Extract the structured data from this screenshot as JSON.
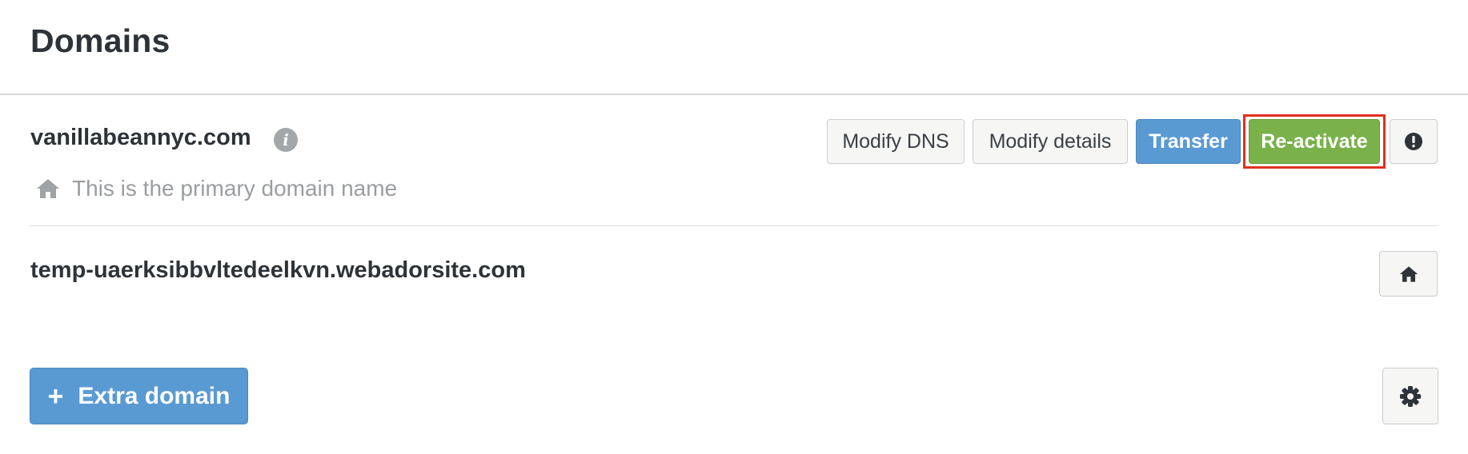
{
  "page": {
    "title": "Domains"
  },
  "domains": [
    {
      "name": "vanillabeannyc.com",
      "info_icon": "info-icon",
      "primary_label": "This is the primary domain name",
      "actions": {
        "modify_dns": "Modify DNS",
        "modify_details": "Modify details",
        "transfer": "Transfer",
        "reactivate": "Re-activate",
        "warning_icon": "exclamation-icon"
      }
    },
    {
      "name": "temp-uaerksibbvltedeelkvn.webadorsite.com",
      "actions": {
        "make_primary_icon": "home-icon"
      }
    }
  ],
  "footer": {
    "add_label": "Extra domain",
    "add_icon": "plus-icon",
    "settings_icon": "gear-icon"
  },
  "colors": {
    "primary_blue": "#5a9ad3",
    "success_green": "#7ab14b",
    "highlight_red": "#e0301e",
    "muted_text": "#9a9da0"
  }
}
